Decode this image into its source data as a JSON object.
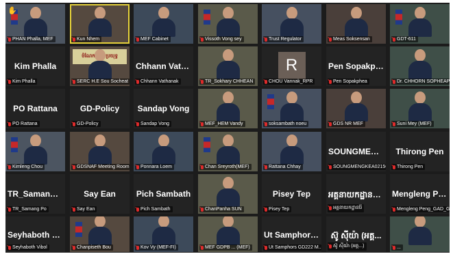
{
  "tiles": [
    {
      "label": "PHAN Phalla, MEF",
      "type": "video",
      "muted": true,
      "hand": true
    },
    {
      "label": "Kun Nhem",
      "type": "video",
      "muted": true,
      "active": true
    },
    {
      "label": "MEF Cabinet",
      "type": "video",
      "muted": true
    },
    {
      "label": "Vissoth Vong sey",
      "type": "video",
      "muted": true
    },
    {
      "label": "Trust Regulator",
      "type": "video",
      "muted": true
    },
    {
      "label": "Meas Soksensan",
      "type": "video",
      "muted": true
    },
    {
      "label": "GDT-611",
      "type": "video",
      "muted": true
    },
    {
      "label": "Kim Phalla",
      "type": "name",
      "name": "Kim Phalla",
      "muted": true
    },
    {
      "label": "SERC H.E Sou Socheat",
      "type": "video",
      "muted": true,
      "banner": "ចំណែកកម្មករប្រយុទ្ធ"
    },
    {
      "label": "Chhann Vathanak",
      "type": "name",
      "name": "Chhann Vathanak",
      "muted": true
    },
    {
      "label": "TR_Sokhary CHHEAN",
      "type": "video",
      "muted": true
    },
    {
      "label": "CHOU Vannak_RPR",
      "type": "letter",
      "letter": "R",
      "muted": true
    },
    {
      "label": "Pen Sopakphea",
      "type": "name",
      "name": "Pen Sopakphea",
      "muted": true
    },
    {
      "label": "Dr. CHHORN SOPHEAP...",
      "type": "video",
      "muted": true
    },
    {
      "label": "PO Rattana",
      "type": "name",
      "name": "PO Rattana",
      "muted": true
    },
    {
      "label": "GD-Policy",
      "type": "name",
      "name": "GD-Policy",
      "muted": true
    },
    {
      "label": "Sandap Vong",
      "type": "name",
      "name": "Sandap Vong",
      "muted": true
    },
    {
      "label": "MEF_HEM Vandy",
      "type": "video",
      "muted": true
    },
    {
      "label": "soksambath noeu",
      "type": "video",
      "muted": true
    },
    {
      "label": "GDS NR MEF",
      "type": "video",
      "muted": true
    },
    {
      "label": "Suni Mey (MEF)",
      "type": "video",
      "muted": true
    },
    {
      "label": "Kimleng Chou",
      "type": "video",
      "muted": true
    },
    {
      "label": "GDSNAF Meeting Room",
      "type": "video",
      "muted": true
    },
    {
      "label": "Ponnara Loem",
      "type": "video",
      "muted": true
    },
    {
      "label": "Chan Sreyroth(MEF)",
      "type": "video",
      "muted": true
    },
    {
      "label": "Rattana Chhay",
      "type": "video",
      "muted": true
    },
    {
      "label": "SOUNGMENGKEA021568",
      "type": "name",
      "name": "SOUNGMENGKE...",
      "muted": true
    },
    {
      "label": "Thirong Pen",
      "type": "name",
      "name": "Thirong Pen",
      "muted": true
    },
    {
      "label": "TR_Samang Po",
      "type": "name",
      "name": "TR_Samang Po",
      "muted": true
    },
    {
      "label": "Say Ean",
      "type": "name",
      "name": "Say Ean",
      "muted": true
    },
    {
      "label": "Pich Sambath",
      "type": "name",
      "name": "Pich Sambath",
      "muted": true
    },
    {
      "label": "ChanPanha SUN",
      "type": "video",
      "muted": true
    },
    {
      "label": "Pisey Tep",
      "type": "name",
      "name": "Pisey Tep",
      "muted": true
    },
    {
      "label": "អគ្គនាយកដ្ឋានរ៉ែ",
      "type": "name",
      "name": "អគ្គនាយកដ្ឋានរ៉ែ...",
      "muted": true
    },
    {
      "label": "Mengleng Peng_GAD_G...",
      "type": "name",
      "name": "Mengleng Peng...",
      "muted": true
    },
    {
      "label": "Seyhaboth Vibol",
      "type": "name",
      "name": "Seyhaboth Vibol",
      "muted": true
    },
    {
      "label": "Chanpiseth Bou",
      "type": "video",
      "muted": true
    },
    {
      "label": "Kov Vy (MEF-FI)",
      "type": "video",
      "muted": true
    },
    {
      "label": "MEF GDPB ... (MEF)",
      "type": "video",
      "muted": true
    },
    {
      "label": "Ut Samphors GD222 M...",
      "type": "name",
      "name": "Ut Samphors_G...",
      "muted": true
    },
    {
      "label": "ស៊ូ ស៊ីយ៉ា (អគ្គ...)",
      "type": "name",
      "name": "ស៊ូ ស៊ីយ៉ា (អគ្គ...",
      "muted": true
    },
    {
      "label": "...",
      "type": "video",
      "muted": true
    }
  ]
}
